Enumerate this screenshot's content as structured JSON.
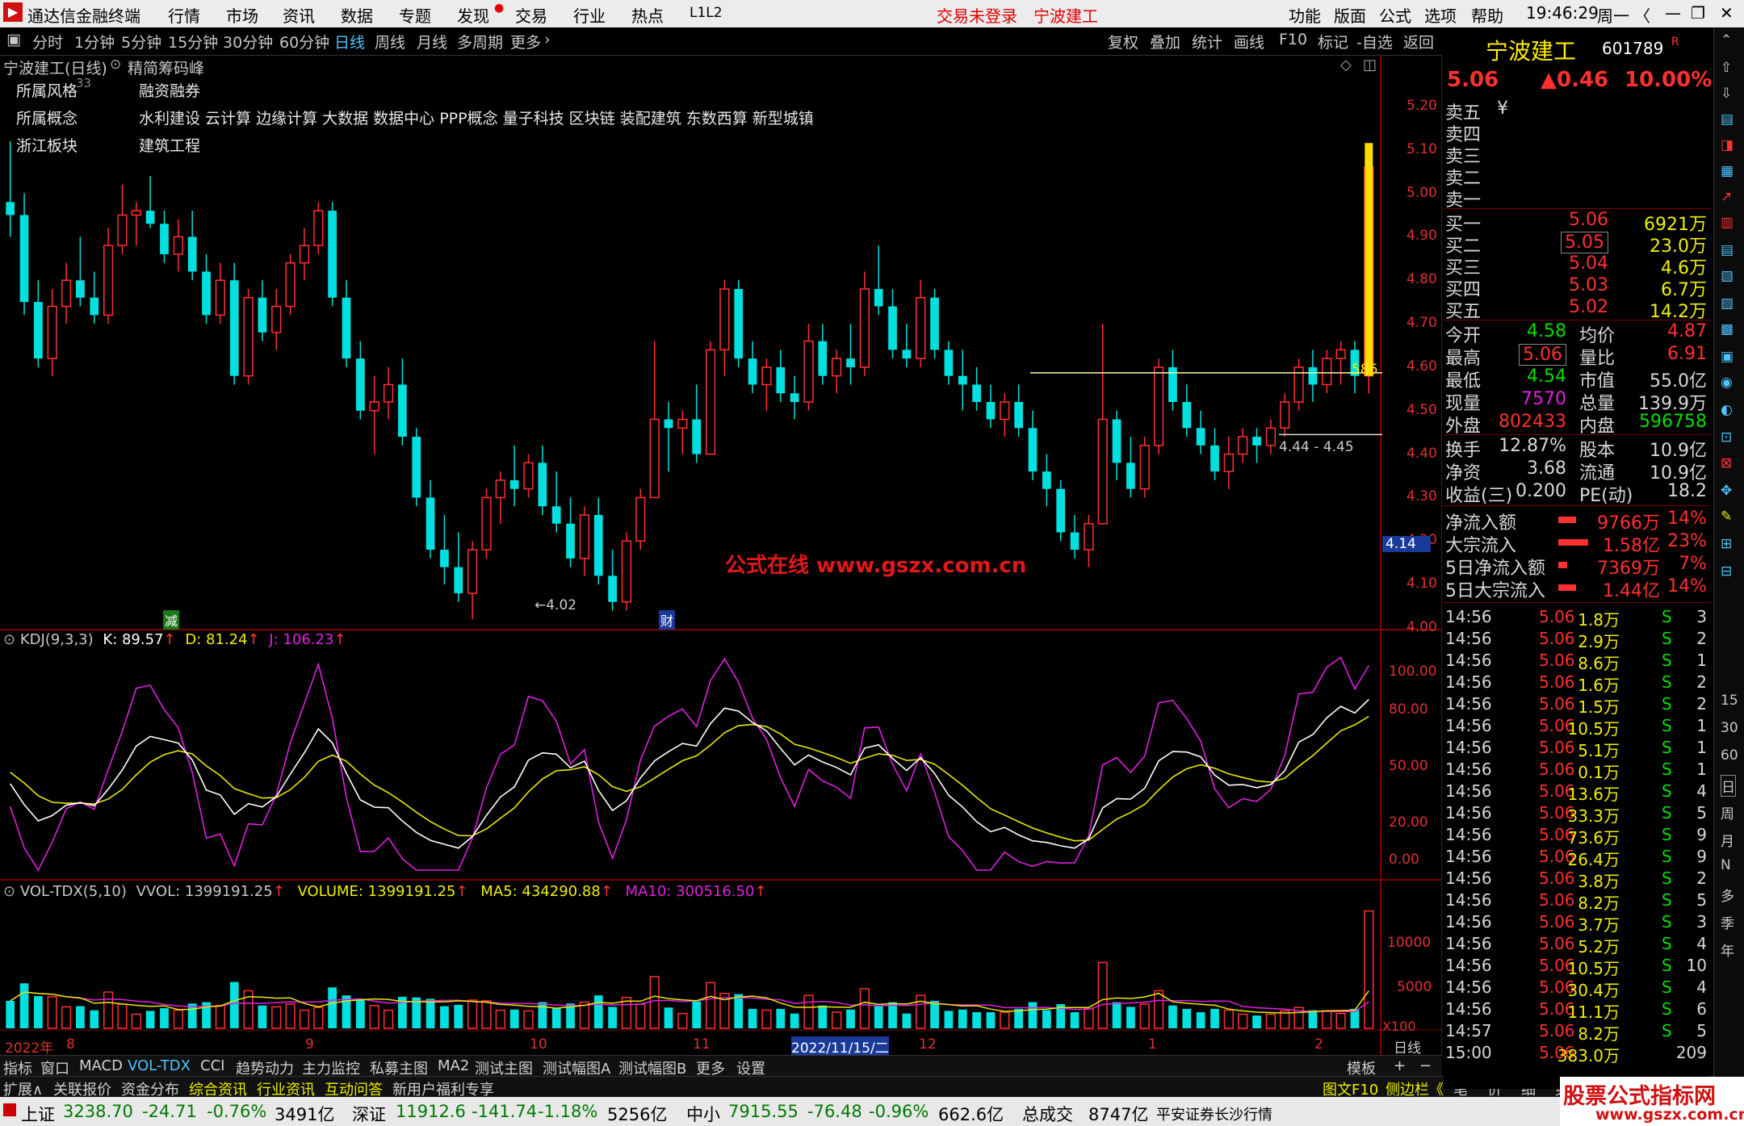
{
  "app": {
    "title": "通达信金融终端",
    "menus": [
      "行情",
      "市场",
      "资讯",
      "数据",
      "专题",
      "发现",
      "交易",
      "行业",
      "热点",
      "L1L2"
    ],
    "trade_status": "交易未登录",
    "stock_short": "宁波建工",
    "right_menus": [
      "功能",
      "版面",
      "公式",
      "选项",
      "帮助"
    ],
    "clock": "19:46:29",
    "weekday": "周一"
  },
  "toolbar": {
    "periods": [
      "分时",
      "1分钟",
      "5分钟",
      "15分钟",
      "30分钟",
      "60分钟",
      "日线",
      "周线",
      "月线",
      "多周期",
      "更多"
    ],
    "active": "日线",
    "right": [
      "复权",
      "叠加",
      "统计",
      "画线",
      "F10",
      "标记",
      "-自选",
      "返回"
    ]
  },
  "chart_header": {
    "title": "宁波建工(日线)",
    "mode": "精简筹码峰"
  },
  "info": {
    "rows": [
      {
        "k": "所属风格",
        "v": "融资融券"
      },
      {
        "k": "所属概念",
        "v": "水利建设 云计算 边缘计算 大数据 数据中心 PPP概念 量子科技 区块链 装配建筑 东数西算 新型城镇"
      },
      {
        "k": "浙江板块",
        "v": "建筑工程"
      }
    ],
    "corner": "33"
  },
  "annotations": {
    "low": "←4.02",
    "range": "4.44 - 4.45",
    "level": "586",
    "marker1": "减",
    "marker2": "财",
    "watermark": "公式在线  www.gszx.com.cn",
    "cur": "4.14"
  },
  "price_axis": {
    "labels": [
      "5.20",
      "5.10",
      "5.00",
      "4.90",
      "4.80",
      "4.70",
      "4.60",
      "4.50",
      "4.40",
      "4.30",
      "4.20",
      "4.10",
      "4.00"
    ]
  },
  "kdj": {
    "title": "KDJ(9,3,3)",
    "k": "K: 89.57",
    "d": "D: 81.24",
    "j": "J: 106.23",
    "axis": [
      "100.00",
      "80.00",
      "50.00",
      "20.00",
      "0.00"
    ]
  },
  "vol": {
    "title": "VOL-TDX(5,10)",
    "vvol": "VVOL: 1399191.25",
    "volume": "VOLUME: 1399191.25",
    "ma5": "MA5: 434290.88",
    "ma10": "MA10: 300516.50",
    "axis": [
      "10000",
      "5000"
    ],
    "unit": "X100"
  },
  "date_axis": {
    "labels": [
      "2022年",
      "8",
      "9",
      "10",
      "11",
      "2022/11/15/二",
      "12",
      "1",
      "2"
    ],
    "period": "日线"
  },
  "bottom_tabs": [
    "指标",
    "窗口",
    "MACD",
    "VOL-TDX",
    "CCI",
    "趋势动力",
    "主力监控",
    "私募主图",
    "MA2",
    "测试主图",
    "测试幅图A",
    "测试幅图B",
    "更多",
    "设置"
  ],
  "bottom_tabs2": [
    "扩展∧",
    "关联报价",
    "资金分布",
    "综合资讯",
    "行业资讯",
    "互动问答",
    "新用户福利专享"
  ],
  "status": {
    "sh": "上证",
    "sh_v": "3238.70",
    "sh_c": "-24.71",
    "sh_p": "-0.76%",
    "sh_a": "3491亿",
    "sz": "深证",
    "sz_v": "11912.6",
    "sz_c": "-141.74",
    "sz_p": "-1.18%",
    "sz_a": "5256亿",
    "zx": "中小",
    "zx_v": "7915.55",
    "zx_c": "-76.48",
    "zx_p": "-0.96%",
    "zx_a": "662.6亿",
    "total": "总成交",
    "total_v": "8747亿",
    "broker": "平安证券长沙行情"
  },
  "quote": {
    "name": "宁波建工",
    "code": "601789",
    "flag": "R",
    "price": "5.06",
    "chg": "▲0.46",
    "pct": "10.00%",
    "sells": [
      {
        "l": "卖五",
        "p": "¥",
        "v": ""
      },
      {
        "l": "卖四",
        "p": "",
        "v": ""
      },
      {
        "l": "卖三",
        "p": "",
        "v": ""
      },
      {
        "l": "卖二",
        "p": "",
        "v": ""
      },
      {
        "l": "卖一",
        "p": "",
        "v": ""
      }
    ],
    "buys": [
      {
        "l": "买一",
        "p": "5.06",
        "v": "6921万"
      },
      {
        "l": "买二",
        "p": "5.05",
        "v": "23.0万"
      },
      {
        "l": "买三",
        "p": "5.04",
        "v": "4.6万"
      },
      {
        "l": "买四",
        "p": "5.03",
        "v": "6.7万"
      },
      {
        "l": "买五",
        "p": "5.02",
        "v": "14.2万"
      }
    ],
    "stats": [
      {
        "a": "今开",
        "av": "4.58",
        "b": "均价",
        "bv": "4.87"
      },
      {
        "a": "最高",
        "av": "5.06",
        "b": "量比",
        "bv": "6.91"
      },
      {
        "a": "最低",
        "av": "4.54",
        "b": "市值",
        "bv": "55.0亿"
      },
      {
        "a": "现量",
        "av": "7570",
        "b": "总量",
        "bv": "139.9万"
      },
      {
        "a": "外盘",
        "av": "802433",
        "b": "内盘",
        "bv": "596758"
      }
    ],
    "stats2": [
      {
        "a": "换手",
        "av": "12.87%",
        "b": "股本",
        "bv": "10.9亿"
      },
      {
        "a": "净资",
        "av": "3.68",
        "b": "流通",
        "bv": "10.9亿"
      },
      {
        "a": "收益(三)",
        "av": "0.200",
        "b": "PE(动)",
        "bv": "18.2"
      }
    ],
    "flows": [
      {
        "l": "净流入额",
        "v": "9766万",
        "p": "14%"
      },
      {
        "l": "大宗流入",
        "v": "1.58亿",
        "p": "23%"
      },
      {
        "l": "5日净流入额",
        "v": "7369万",
        "p": "7%"
      },
      {
        "l": "5日大宗流入",
        "v": "1.44亿",
        "p": "14%"
      }
    ],
    "flow_bars": [
      0.14,
      0.23,
      0.07,
      0.14
    ]
  },
  "ticks": [
    [
      "14:56",
      "5.06",
      "1.8万",
      "S",
      "3"
    ],
    [
      "14:56",
      "5.06",
      "2.9万",
      "S",
      "2"
    ],
    [
      "14:56",
      "5.06",
      "8.6万",
      "S",
      "1"
    ],
    [
      "14:56",
      "5.06",
      "1.6万",
      "S",
      "2"
    ],
    [
      "14:56",
      "5.06",
      "1.5万",
      "S",
      "2"
    ],
    [
      "14:56",
      "5.06",
      "10.5万",
      "S",
      "1"
    ],
    [
      "14:56",
      "5.06",
      "5.1万",
      "S",
      "1"
    ],
    [
      "14:56",
      "5.06",
      "0.1万",
      "S",
      "1"
    ],
    [
      "14:56",
      "5.06",
      "13.6万",
      "S",
      "4"
    ],
    [
      "14:56",
      "5.06",
      "33.3万",
      "S",
      "5"
    ],
    [
      "14:56",
      "5.06",
      "73.6万",
      "S",
      "9"
    ],
    [
      "14:56",
      "5.06",
      "26.4万",
      "S",
      "9"
    ],
    [
      "14:56",
      "5.06",
      "3.8万",
      "S",
      "2"
    ],
    [
      "14:56",
      "5.06",
      "8.2万",
      "S",
      "5"
    ],
    [
      "14:56",
      "5.06",
      "3.7万",
      "S",
      "3"
    ],
    [
      "14:56",
      "5.06",
      "5.2万",
      "S",
      "4"
    ],
    [
      "14:56",
      "5.06",
      "10.5万",
      "S",
      "10"
    ],
    [
      "14:56",
      "5.06",
      "30.4万",
      "S",
      "4"
    ],
    [
      "14:56",
      "5.06",
      "11.1万",
      "S",
      "6"
    ],
    [
      "14:57",
      "5.06",
      "8.2万",
      "S",
      "5"
    ],
    [
      "15:00",
      "5.06",
      "383.0万",
      "",
      "209"
    ]
  ],
  "right_tabs": [
    "图文F10",
    "侧边栏《",
    "笔",
    "价",
    "细",
    "势",
    "联"
  ],
  "sidebar": [
    "15",
    "30",
    "60",
    "日",
    "周",
    "月",
    "N",
    "多",
    "季",
    "年"
  ],
  "brand": {
    "top": "股票公式指标网",
    "bottom": "www.gszx.com.cn"
  },
  "colors": {
    "up": "#ff3030",
    "down": "#00e0e0",
    "k": "#ffffff",
    "d": "#e8e800",
    "j": "#e020e0"
  },
  "chart_data": {
    "type": "candlestick",
    "ohlc": [
      [
        4.98,
        5.12,
        4.9,
        4.95
      ],
      [
        4.95,
        5.0,
        4.72,
        4.75
      ],
      [
        4.75,
        4.8,
        4.6,
        4.62
      ],
      [
        4.62,
        4.78,
        4.58,
        4.74
      ],
      [
        4.74,
        4.84,
        4.7,
        4.8
      ],
      [
        4.8,
        4.9,
        4.74,
        4.76
      ],
      [
        4.76,
        4.82,
        4.7,
        4.72
      ],
      [
        4.72,
        4.92,
        4.7,
        4.88
      ],
      [
        4.88,
        5.02,
        4.86,
        4.95
      ],
      [
        4.95,
        4.98,
        4.88,
        4.96
      ],
      [
        4.96,
        5.04,
        4.92,
        4.93
      ],
      [
        4.93,
        4.96,
        4.84,
        4.86
      ],
      [
        4.86,
        4.94,
        4.82,
        4.9
      ],
      [
        4.9,
        4.96,
        4.8,
        4.82
      ],
      [
        4.82,
        4.86,
        4.7,
        4.72
      ],
      [
        4.72,
        4.84,
        4.7,
        4.8
      ],
      [
        4.8,
        4.84,
        4.56,
        4.58
      ],
      [
        4.58,
        4.78,
        4.56,
        4.76
      ],
      [
        4.76,
        4.8,
        4.66,
        4.68
      ],
      [
        4.68,
        4.78,
        4.64,
        4.74
      ],
      [
        4.74,
        4.86,
        4.72,
        4.84
      ],
      [
        4.84,
        4.92,
        4.8,
        4.88
      ],
      [
        4.88,
        4.98,
        4.86,
        4.96
      ],
      [
        4.96,
        4.98,
        4.74,
        4.76
      ],
      [
        4.76,
        4.8,
        4.6,
        4.62
      ],
      [
        4.62,
        4.66,
        4.48,
        4.5
      ],
      [
        4.5,
        4.58,
        4.4,
        4.52
      ],
      [
        4.52,
        4.6,
        4.48,
        4.56
      ],
      [
        4.56,
        4.62,
        4.42,
        4.44
      ],
      [
        4.44,
        4.46,
        4.28,
        4.3
      ],
      [
        4.3,
        4.34,
        4.16,
        4.18
      ],
      [
        4.18,
        4.26,
        4.1,
        4.14
      ],
      [
        4.14,
        4.22,
        4.06,
        4.08
      ],
      [
        4.08,
        4.2,
        4.02,
        4.18
      ],
      [
        4.18,
        4.32,
        4.16,
        4.3
      ],
      [
        4.3,
        4.36,
        4.24,
        4.34
      ],
      [
        4.34,
        4.42,
        4.28,
        4.32
      ],
      [
        4.32,
        4.4,
        4.3,
        4.38
      ],
      [
        4.38,
        4.42,
        4.26,
        4.28
      ],
      [
        4.28,
        4.36,
        4.22,
        4.24
      ],
      [
        4.24,
        4.3,
        4.14,
        4.16
      ],
      [
        4.16,
        4.28,
        4.12,
        4.26
      ],
      [
        4.26,
        4.3,
        4.1,
        4.12
      ],
      [
        4.12,
        4.18,
        4.04,
        4.06
      ],
      [
        4.06,
        4.22,
        4.04,
        4.2
      ],
      [
        4.2,
        4.32,
        4.18,
        4.3
      ],
      [
        4.3,
        4.66,
        4.3,
        4.48
      ],
      [
        4.48,
        4.52,
        4.36,
        4.46
      ],
      [
        4.46,
        4.5,
        4.4,
        4.48
      ],
      [
        4.48,
        4.56,
        4.38,
        4.4
      ],
      [
        4.4,
        4.66,
        4.4,
        4.64
      ],
      [
        4.64,
        4.8,
        4.58,
        4.78
      ],
      [
        4.78,
        4.8,
        4.6,
        4.62
      ],
      [
        4.62,
        4.66,
        4.54,
        4.56
      ],
      [
        4.56,
        4.62,
        4.5,
        4.6
      ],
      [
        4.6,
        4.64,
        4.52,
        4.54
      ],
      [
        4.54,
        4.58,
        4.48,
        4.52
      ],
      [
        4.52,
        4.7,
        4.5,
        4.66
      ],
      [
        4.66,
        4.7,
        4.56,
        4.58
      ],
      [
        4.58,
        4.64,
        4.54,
        4.62
      ],
      [
        4.62,
        4.7,
        4.56,
        4.6
      ],
      [
        4.6,
        4.82,
        4.58,
        4.78
      ],
      [
        4.78,
        4.88,
        4.72,
        4.74
      ],
      [
        4.74,
        4.78,
        4.62,
        4.64
      ],
      [
        4.64,
        4.7,
        4.6,
        4.62
      ],
      [
        4.62,
        4.8,
        4.6,
        4.76
      ],
      [
        4.76,
        4.78,
        4.62,
        4.64
      ],
      [
        4.64,
        4.66,
        4.56,
        4.58
      ],
      [
        4.58,
        4.64,
        4.5,
        4.56
      ],
      [
        4.56,
        4.6,
        4.5,
        4.52
      ],
      [
        4.52,
        4.56,
        4.46,
        4.48
      ],
      [
        4.48,
        4.54,
        4.44,
        4.52
      ],
      [
        4.52,
        4.56,
        4.44,
        4.46
      ],
      [
        4.46,
        4.5,
        4.34,
        4.36
      ],
      [
        4.36,
        4.4,
        4.28,
        4.32
      ],
      [
        4.32,
        4.34,
        4.2,
        4.22
      ],
      [
        4.22,
        4.26,
        4.16,
        4.18
      ],
      [
        4.18,
        4.26,
        4.14,
        4.24
      ],
      [
        4.24,
        4.7,
        4.24,
        4.48
      ],
      [
        4.48,
        4.5,
        4.34,
        4.38
      ],
      [
        4.38,
        4.44,
        4.3,
        4.32
      ],
      [
        4.32,
        4.44,
        4.3,
        4.42
      ],
      [
        4.42,
        4.62,
        4.4,
        4.6
      ],
      [
        4.6,
        4.64,
        4.5,
        4.52
      ],
      [
        4.52,
        4.56,
        4.44,
        4.46
      ],
      [
        4.46,
        4.5,
        4.4,
        4.42
      ],
      [
        4.42,
        4.46,
        4.34,
        4.36
      ],
      [
        4.36,
        4.44,
        4.32,
        4.4
      ],
      [
        4.4,
        4.46,
        4.38,
        4.44
      ],
      [
        4.44,
        4.46,
        4.38,
        4.42
      ],
      [
        4.42,
        4.48,
        4.4,
        4.46
      ],
      [
        4.46,
        4.54,
        4.44,
        4.52
      ],
      [
        4.52,
        4.62,
        4.5,
        4.6
      ],
      [
        4.6,
        4.64,
        4.52,
        4.56
      ],
      [
        4.56,
        4.64,
        4.54,
        4.62
      ],
      [
        4.62,
        4.66,
        4.56,
        4.64
      ],
      [
        4.64,
        4.66,
        4.54,
        4.58
      ],
      [
        4.58,
        5.06,
        4.54,
        5.06
      ]
    ],
    "ylim": [
      4.0,
      5.3
    ],
    "kdj_ylim": [
      -5,
      115
    ]
  }
}
